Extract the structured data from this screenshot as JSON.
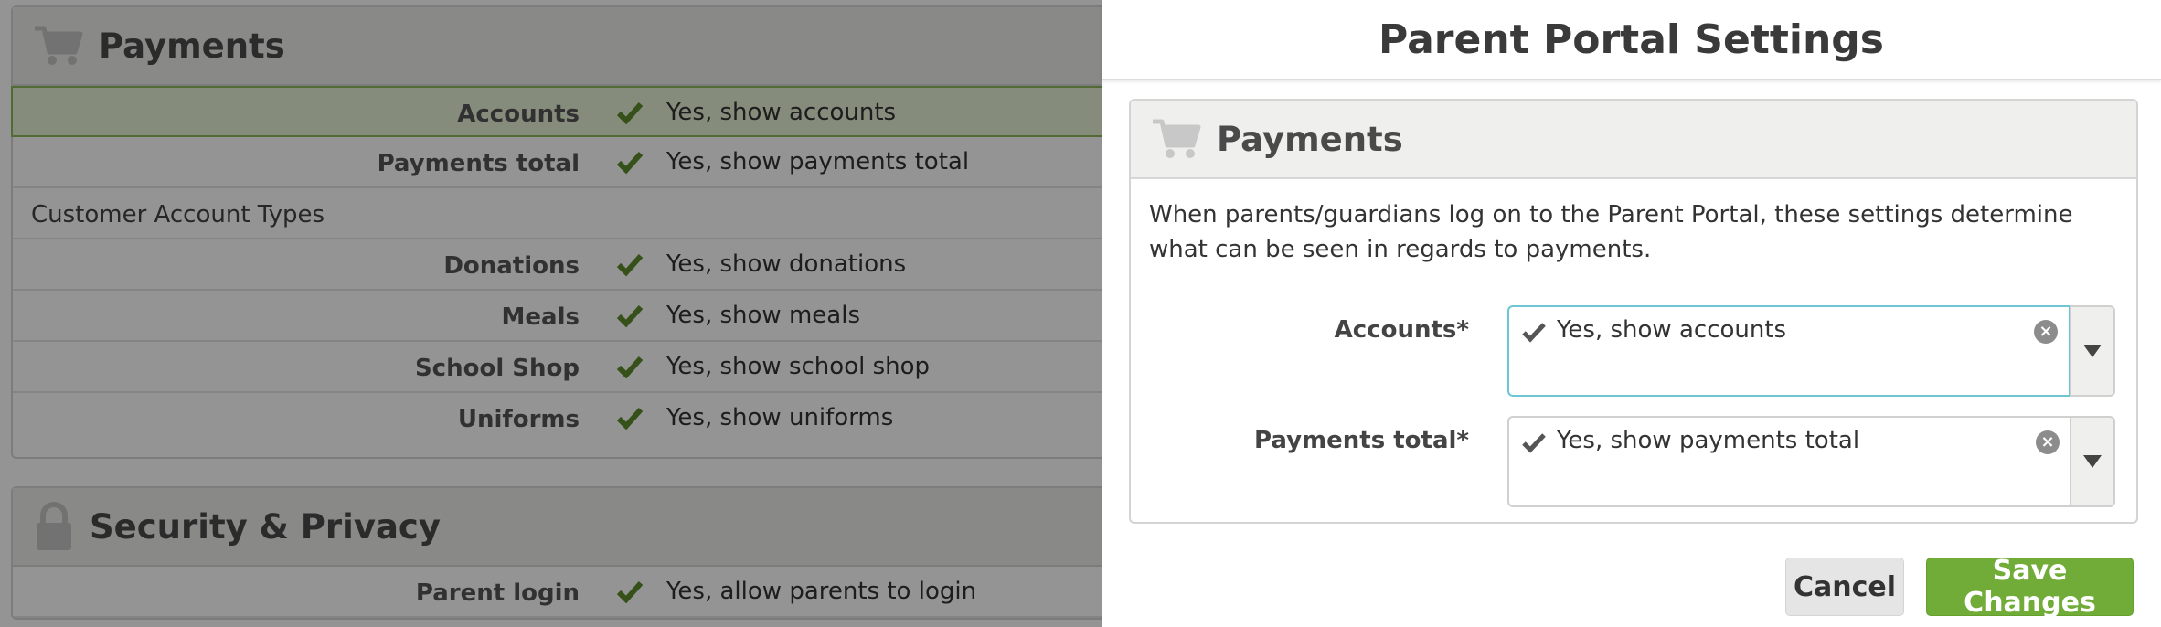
{
  "background": {
    "payments_panel": {
      "title": "Payments",
      "icon": "cart-icon",
      "rows": [
        {
          "label": "Accounts",
          "value": "Yes, show accounts"
        },
        {
          "label": "Payments total",
          "value": "Yes, show payments total"
        },
        {
          "subheading": "Customer Account Types"
        },
        {
          "label": "Donations",
          "value": "Yes, show donations"
        },
        {
          "label": "Meals",
          "value": "Yes, show meals"
        },
        {
          "label": "School Shop",
          "value": "Yes, show school shop"
        },
        {
          "label": "Uniforms",
          "value": "Yes, show uniforms"
        }
      ]
    },
    "security_panel": {
      "title": "Security & Privacy",
      "icon": "lock-icon",
      "rows": [
        {
          "label": "Parent login",
          "value": "Yes, allow parents to login"
        }
      ]
    }
  },
  "modal": {
    "title": "Parent Portal Settings",
    "panel": {
      "title": "Payments",
      "icon": "cart-icon",
      "description": "When parents/guardians log on to the Parent Portal, these settings determine what can be seen in regards to payments.",
      "fields": [
        {
          "label": "Accounts*",
          "value": "Yes, show accounts"
        },
        {
          "label": "Payments total*",
          "value": "Yes, show payments total"
        }
      ]
    },
    "buttons": {
      "cancel": "Cancel",
      "save": "Save Changes"
    }
  },
  "colors": {
    "accent_green": "#70ac37",
    "check_green": "#5c8a2a",
    "focus_cyan": "#6cc6d4"
  }
}
